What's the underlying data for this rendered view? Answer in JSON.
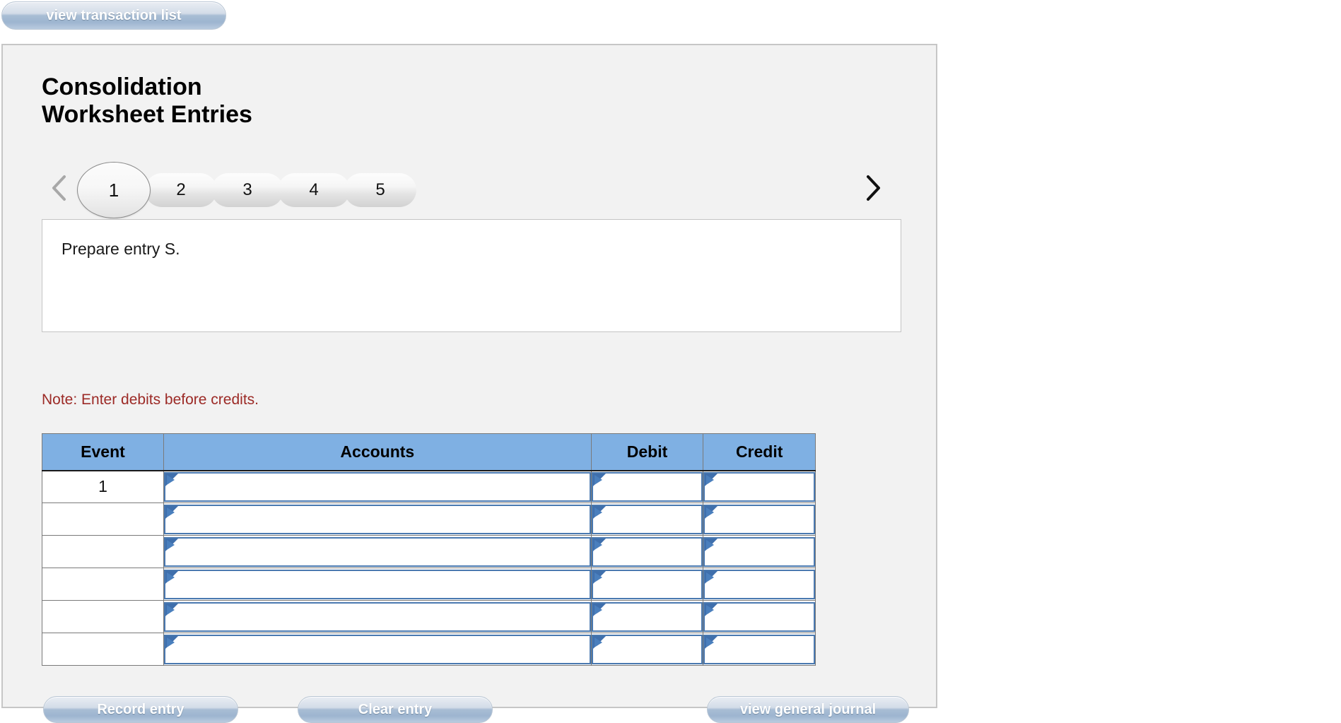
{
  "toolbar": {
    "view_transaction_list_label": "view transaction list"
  },
  "panel": {
    "title": "Consolidation\nWorksheet Entries",
    "pager": {
      "prev_icon": "chevron-left-icon",
      "next_icon": "chevron-right-icon",
      "prev_enabled": false,
      "next_enabled": true,
      "active_index": 0,
      "tabs": [
        {
          "label": "1"
        },
        {
          "label": "2"
        },
        {
          "label": "3"
        },
        {
          "label": "4"
        },
        {
          "label": "5"
        }
      ]
    },
    "instruction": {
      "text": "Prepare entry S."
    },
    "note": {
      "text": "Note: Enter debits before credits.",
      "color": "#9c2a26"
    },
    "table": {
      "header_color": "#7fb0e3",
      "columns": [
        {
          "key": "event",
          "label": "Event"
        },
        {
          "key": "accounts",
          "label": "Accounts"
        },
        {
          "key": "debit",
          "label": "Debit"
        },
        {
          "key": "credit",
          "label": "Credit"
        }
      ],
      "rows": [
        {
          "event": "1",
          "accounts": "",
          "debit": "",
          "credit": ""
        },
        {
          "event": "",
          "accounts": "",
          "debit": "",
          "credit": ""
        },
        {
          "event": "",
          "accounts": "",
          "debit": "",
          "credit": ""
        },
        {
          "event": "",
          "accounts": "",
          "debit": "",
          "credit": ""
        },
        {
          "event": "",
          "accounts": "",
          "debit": "",
          "credit": ""
        },
        {
          "event": "",
          "accounts": "",
          "debit": "",
          "credit": ""
        }
      ]
    },
    "actions": {
      "record_entry_label": "Record entry",
      "clear_entry_label": "Clear entry",
      "view_general_journal_label": "view general journal"
    }
  }
}
